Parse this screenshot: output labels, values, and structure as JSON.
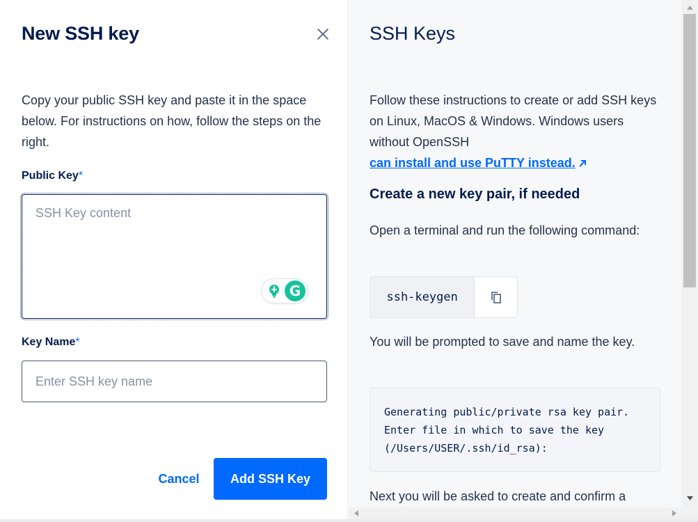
{
  "left_panel": {
    "title": "New SSH key",
    "intro": "Copy your public SSH key and paste it in the space below. For instructions on how, follow the steps on the right.",
    "public_key": {
      "label": "Public Key",
      "required_mark": "*",
      "placeholder": "SSH Key content",
      "value": ""
    },
    "key_name": {
      "label": "Key Name",
      "required_mark": "*",
      "placeholder": "Enter SSH key name",
      "value": ""
    },
    "cancel_label": "Cancel",
    "submit_label": "Add SSH Key",
    "grammarly_logo": "G"
  },
  "right_panel": {
    "title": "SSH Keys",
    "intro": "Follow these instructions to create or add SSH keys on Linux, MacOS & Windows. Windows users without OpenSSH",
    "putty_link": "can install and use PuTTY instead.",
    "section_heading": "Create a new key pair, if needed",
    "step1": "Open a terminal and run the following command:",
    "command": "ssh-keygen",
    "step2": "You will be prompted to save and name the key.",
    "code_output": "Generating public/private rsa key pair. Enter file in which to save the key (/Users/USER/.ssh/id_rsa):",
    "step3": "Next you will be asked to create and confirm a"
  },
  "icons": {
    "close": "close-icon",
    "copy": "copy-icon",
    "external_link": "arrow-up-right-icon",
    "grammarly_bulb": "lightbulb-icon",
    "grammarly_logo": "grammarly-logo"
  },
  "colors": {
    "accent": "#0069ff",
    "heading": "#031b4e",
    "text": "#24324d",
    "placeholder": "#8892a2",
    "right_bg": "#f7f8fa",
    "grammarly": "#15c39a"
  }
}
